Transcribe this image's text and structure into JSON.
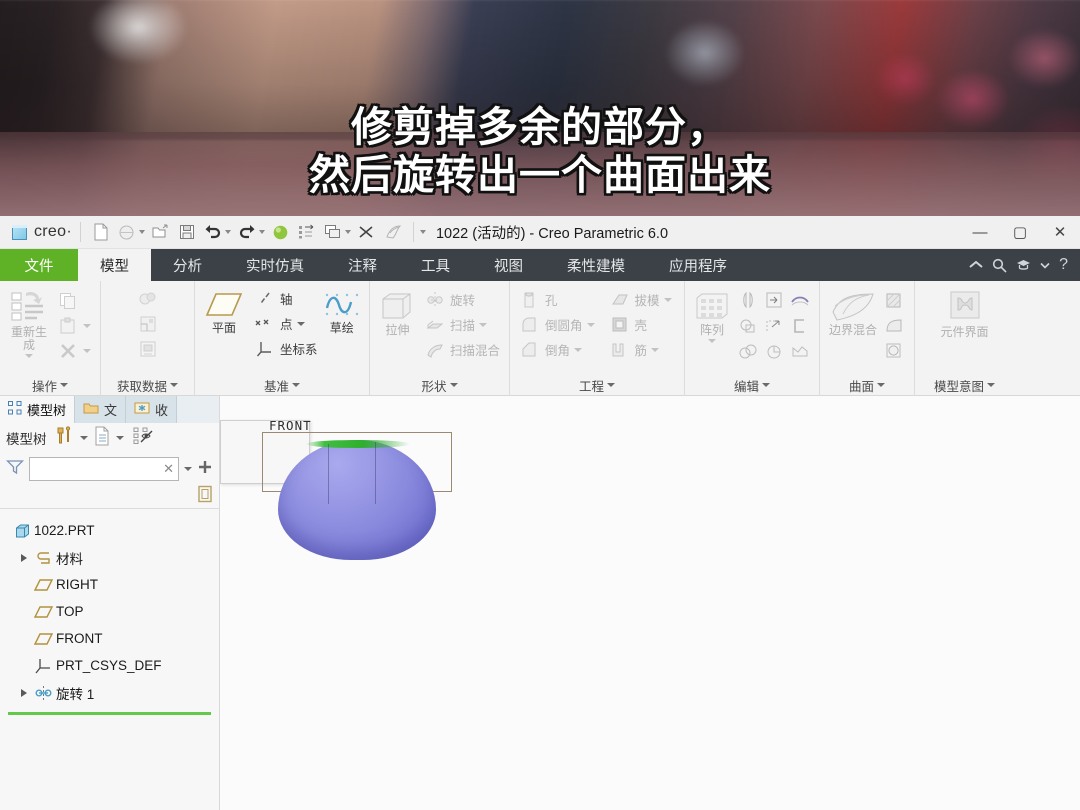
{
  "video": {
    "subtitle_line1": "修剪掉多余的部分，",
    "subtitle_line2": "然后旋转出一个曲面出来"
  },
  "titlebar": {
    "brand": "creo·",
    "title": "1022 (活动的) - Creo Parametric 6.0",
    "quick_access": [
      {
        "name": "new-icon",
        "glyph": "new"
      },
      {
        "name": "open-recent-icon",
        "glyph": "circle"
      },
      {
        "name": "open-icon",
        "glyph": "folder"
      },
      {
        "name": "save-icon",
        "glyph": "save"
      },
      {
        "name": "undo-icon",
        "glyph": "undo"
      },
      {
        "name": "redo-icon",
        "glyph": "redo"
      },
      {
        "name": "regenerate-icon",
        "glyph": "green-ball"
      },
      {
        "name": "switch-window-icon",
        "glyph": "switch"
      },
      {
        "name": "window-icon",
        "glyph": "windows"
      },
      {
        "name": "close-window-icon",
        "glyph": "xx"
      },
      {
        "name": "appearance-icon",
        "glyph": "sheet"
      }
    ],
    "window_controls": {
      "minimize": "—",
      "maximize": "▢",
      "close": "✕"
    }
  },
  "ribbon": {
    "tabs": [
      {
        "label": "文件",
        "active": false,
        "kind": "file"
      },
      {
        "label": "模型",
        "active": true
      },
      {
        "label": "分析",
        "active": false
      },
      {
        "label": "实时仿真",
        "active": false
      },
      {
        "label": "注释",
        "active": false
      },
      {
        "label": "工具",
        "active": false
      },
      {
        "label": "视图",
        "active": false
      },
      {
        "label": "柔性建模",
        "active": false
      },
      {
        "label": "应用程序",
        "active": false
      }
    ],
    "right_icons": [
      {
        "name": "collapse-ribbon-icon",
        "glyph": "^"
      },
      {
        "name": "search-icon",
        "glyph": "search"
      },
      {
        "name": "help-menu-icon",
        "glyph": "cap"
      },
      {
        "name": "help-caret-icon",
        "glyph": "caret"
      },
      {
        "name": "help-icon",
        "glyph": "?"
      }
    ],
    "groups": [
      {
        "title": "操作",
        "big": {
          "label": "重新生成",
          "enabled": false,
          "name": "regenerate-button"
        },
        "items": [
          {
            "label": "",
            "name": "copy-button",
            "enabled": false
          },
          {
            "label": "",
            "name": "paste-button",
            "enabled": false
          },
          {
            "label": "",
            "name": "delete-button",
            "enabled": false
          }
        ]
      },
      {
        "title": "获取数据",
        "items": [
          {
            "label": "",
            "name": "merge-inherit-button",
            "enabled": false
          },
          {
            "label": "",
            "name": "shrinkwrap-button",
            "enabled": false
          },
          {
            "label": "",
            "name": "copy-geometry-button",
            "enabled": false
          }
        ]
      },
      {
        "title": "基准",
        "big": {
          "label": "平面",
          "enabled": true,
          "name": "datum-plane-button"
        },
        "items": [
          {
            "label": "轴",
            "name": "datum-axis-button",
            "enabled": true
          },
          {
            "label": "点",
            "name": "datum-point-button",
            "enabled": true,
            "caret": true
          },
          {
            "label": "坐标系",
            "name": "coordinate-system-button",
            "enabled": true
          }
        ],
        "extra": {
          "label": "草绘",
          "name": "sketch-button",
          "enabled": true
        }
      },
      {
        "title": "形状",
        "big": {
          "label": "拉伸",
          "enabled": false,
          "name": "extrude-button"
        },
        "items": [
          {
            "label": "旋转",
            "name": "revolve-button",
            "enabled": false
          },
          {
            "label": "扫描",
            "name": "sweep-button",
            "enabled": false,
            "caret": true
          },
          {
            "label": "扫描混合",
            "name": "swept-blend-button",
            "enabled": false
          }
        ]
      },
      {
        "title": "工程",
        "items_left": [
          {
            "label": "孔",
            "name": "hole-button",
            "enabled": false
          },
          {
            "label": "倒圆角",
            "name": "round-button",
            "enabled": false,
            "caret": true
          },
          {
            "label": "倒角",
            "name": "chamfer-button",
            "enabled": false,
            "caret": true
          }
        ],
        "items_right": [
          {
            "label": "拔模",
            "name": "draft-button",
            "enabled": false,
            "caret": true
          },
          {
            "label": "壳",
            "name": "shell-button",
            "enabled": false
          },
          {
            "label": "筋",
            "name": "rib-button",
            "enabled": false,
            "caret": true
          }
        ]
      },
      {
        "title": "编辑",
        "big": {
          "label": "阵列",
          "enabled": false,
          "name": "pattern-button"
        },
        "grid": [
          {
            "name": "mirror-button"
          },
          {
            "name": "extend-button"
          },
          {
            "name": "project-button"
          },
          {
            "name": "intersect-button"
          },
          {
            "name": "trim-button"
          },
          {
            "name": "offset-button"
          },
          {
            "name": "merge-button"
          },
          {
            "name": "solidify-button"
          },
          {
            "name": "thicken-button"
          }
        ]
      },
      {
        "title": "曲面",
        "big": {
          "label": "边界混合",
          "enabled": false,
          "name": "boundary-blend-button"
        },
        "items": [
          {
            "name": "fill-button"
          },
          {
            "name": "style-button"
          },
          {
            "name": "freestyle-button"
          }
        ]
      },
      {
        "title": "模型意图",
        "big": {
          "label": "元件界面",
          "enabled": false,
          "name": "component-interface-button"
        }
      }
    ]
  },
  "tree_panel": {
    "tabs": [
      {
        "label": "模型树",
        "active": true,
        "name": "tab-model-tree",
        "icon": "tree-icon"
      },
      {
        "label": "文",
        "active": false,
        "name": "tab-folder-browser",
        "icon": "folder-icon"
      },
      {
        "label": "收",
        "active": false,
        "name": "tab-favorites",
        "icon": "favorites-icon"
      }
    ],
    "toolbar_label": "模型树",
    "toolbar_icons": [
      {
        "name": "settings-tools-icon"
      },
      {
        "name": "settings-caret-icon"
      },
      {
        "name": "tree-columns-icon"
      },
      {
        "name": "tree-columns-caret-icon"
      },
      {
        "name": "tree-filters-icon"
      }
    ],
    "filter": {
      "value": "",
      "placeholder": "",
      "clear": "✕"
    },
    "filter_icons": [
      {
        "name": "filter-funnel-icon"
      },
      {
        "name": "filter-caret-icon"
      },
      {
        "name": "filter-add-icon"
      }
    ],
    "subbar_icon": {
      "name": "fit-window-icon"
    },
    "nodes": [
      {
        "label": "1022.PRT",
        "icon": "part-icon",
        "indent": 0,
        "arrow": false
      },
      {
        "label": "材料",
        "icon": "material-icon",
        "indent": 1,
        "arrow": true
      },
      {
        "label": "RIGHT",
        "icon": "datum-plane-icon",
        "indent": 1,
        "arrow": false
      },
      {
        "label": "TOP",
        "icon": "datum-plane-icon",
        "indent": 1,
        "arrow": false
      },
      {
        "label": "FRONT",
        "icon": "datum-plane-icon",
        "indent": 1,
        "arrow": false
      },
      {
        "label": "PRT_CSYS_DEF",
        "icon": "csys-icon",
        "indent": 1,
        "arrow": false
      },
      {
        "label": "旋转 1",
        "icon": "revolve-icon",
        "indent": 1,
        "arrow": true
      }
    ],
    "insert_indicator_color": "#62c94a"
  },
  "viewport": {
    "view_label": "FRONT",
    "model_color": "#8e8ee0",
    "highlight_color": "#3fbe3f"
  }
}
